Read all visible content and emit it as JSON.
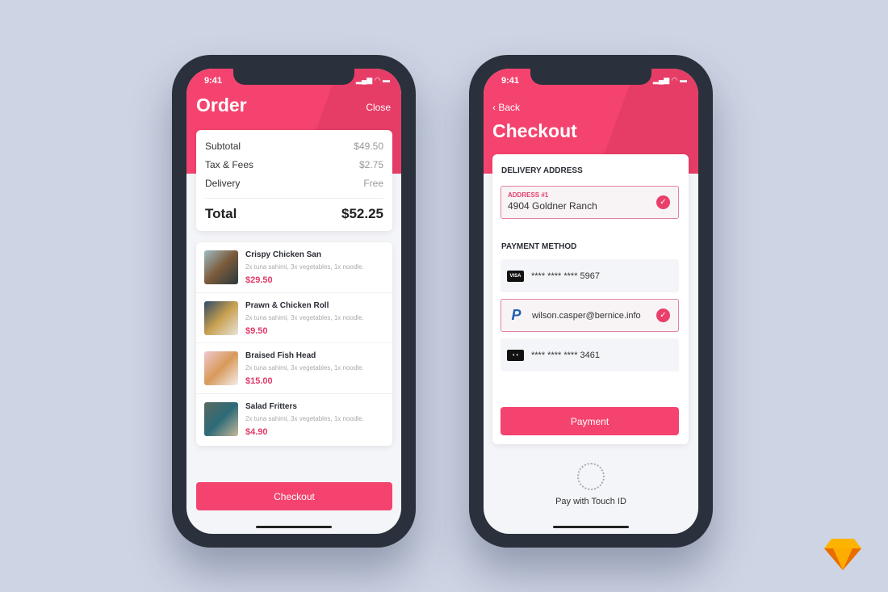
{
  "status": {
    "time": "9:41",
    "icons": "signal-wifi-battery"
  },
  "order": {
    "title": "Order",
    "close": "Close",
    "summary": [
      {
        "label": "Subtotal",
        "value": "$49.50"
      },
      {
        "label": "Tax & Fees",
        "value": "$2.75"
      },
      {
        "label": "Delivery",
        "value": "Free"
      }
    ],
    "total_label": "Total",
    "total_value": "$52.25",
    "items": [
      {
        "name": "Crispy Chicken San",
        "desc": "2x tuna sahimi, 3x vegetables, 1x noodle.",
        "price": "$29.50"
      },
      {
        "name": "Prawn & Chicken Roll",
        "desc": "2x tuna sahimi, 3x vegetables, 1x noodle.",
        "price": "$9.50"
      },
      {
        "name": "Braised Fish Head",
        "desc": "2x tuna sahimi, 3x vegetables, 1x noodle.",
        "price": "$15.00"
      },
      {
        "name": "Salad Fritters",
        "desc": "2x tuna sahimi, 3x vegetables, 1x noodle.",
        "price": "$4.90"
      }
    ],
    "checkout": "Checkout"
  },
  "checkout": {
    "back": "Back",
    "title": "Checkout",
    "delivery_heading": "DELIVERY ADDRESS",
    "address_label": "ADDRESS #1",
    "address": "4904 Goldner Ranch",
    "payment_heading": "PAYMENT METHOD",
    "methods": [
      {
        "logo": "VISA",
        "text": "**** **** **** 5967",
        "selected": false
      },
      {
        "logo": "P",
        "text": "wilson.casper@bernice.info",
        "selected": true
      },
      {
        "logo": "MC",
        "text": "**** **** **** 3461",
        "selected": false
      }
    ],
    "payment": "Payment",
    "touch_id": "Pay with Touch ID"
  },
  "colors": {
    "accent": "#f4436e",
    "background": "#cdd4e4"
  }
}
